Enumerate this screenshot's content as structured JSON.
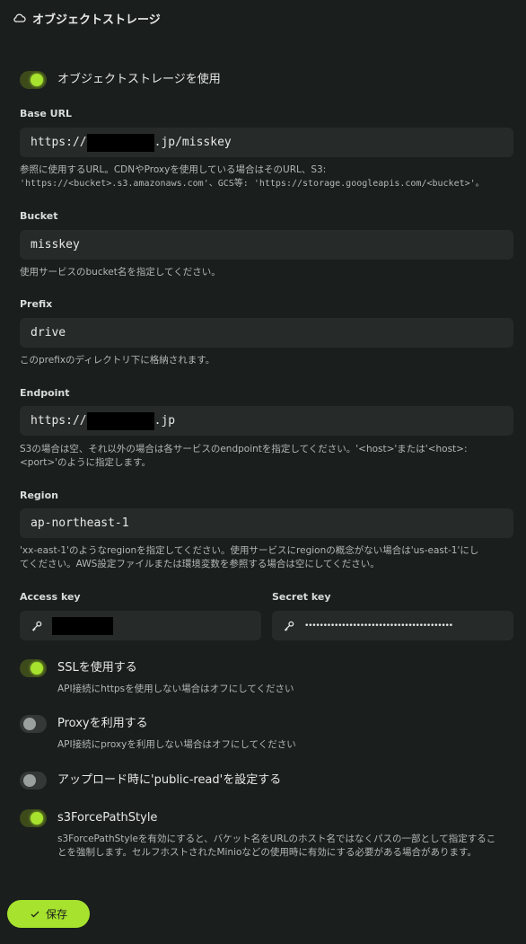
{
  "header": {
    "title": "オブジェクトストレージ"
  },
  "use_object_storage": {
    "label": "オブジェクトストレージを使用",
    "enabled": true
  },
  "base_url": {
    "label": "Base URL",
    "value_prefix": "https://",
    "value_suffix": ".jp/misskey",
    "caption_line1": "参照に使用するURL。CDNやProxyを使用している場合はそのURL、S3:",
    "caption_line2": "'https://<bucket>.s3.amazonaws.com'、GCS等: 'https://storage.googleapis.com/<bucket>'。"
  },
  "bucket": {
    "label": "Bucket",
    "value": "misskey",
    "caption": "使用サービスのbucket名を指定してください。"
  },
  "prefix": {
    "label": "Prefix",
    "value": "drive",
    "caption": "このprefixのディレクトリ下に格納されます。"
  },
  "endpoint": {
    "label": "Endpoint",
    "value_prefix": "https://",
    "value_suffix": ".jp",
    "caption_line1": "S3の場合は空、それ以外の場合は各サービスのendpointを指定してください。'<host>'または'<host>:",
    "caption_line2": "<port>'のように指定します。"
  },
  "region": {
    "label": "Region",
    "value": "ap-northeast-1",
    "caption_line1": "'xx-east-1'のようなregionを指定してください。使用サービスにregionの概念がない場合は'us-east-1'にし",
    "caption_line2": "てください。AWS設定ファイルまたは環境変数を参照する場合は空にしてください。"
  },
  "access_key": {
    "label": "Access key",
    "icon": "key-icon"
  },
  "secret_key": {
    "label": "Secret key",
    "masked": "••••••••••••••••••••••••••••••••••••••••",
    "icon": "key-icon"
  },
  "ssl": {
    "label": "SSLを使用する",
    "caption": "API接続にhttpsを使用しない場合はオフにしてください",
    "enabled": true
  },
  "proxy": {
    "label": "Proxyを利用する",
    "caption": "API接続にproxyを利用しない場合はオフにしてください",
    "enabled": false
  },
  "public_read": {
    "label": "アップロード時に'public-read'を設定する",
    "enabled": false
  },
  "force_path_style": {
    "label": "s3ForcePathStyle",
    "caption_line1": "s3ForcePathStyleを有効にすると、バケット名をURLのホスト名ではなくパスの一部として指定するこ",
    "caption_line2": "とを強制します。セルフホストされたMinioなどの使用時に有効にする必要がある場合があります。",
    "enabled": true
  },
  "save": {
    "label": "保存",
    "icon": "check-icon"
  },
  "colors": {
    "accent": "#a6e22e",
    "background": "#1a1e1d",
    "input_bg": "#262b29"
  }
}
